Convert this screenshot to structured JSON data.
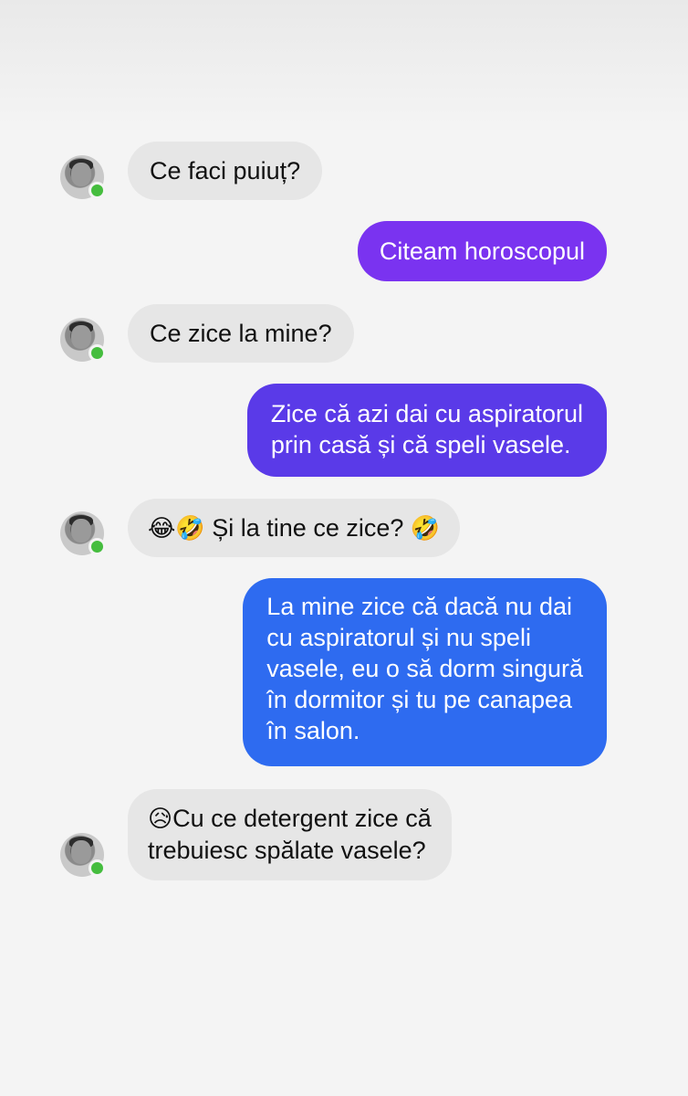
{
  "messages": [
    {
      "side": "incoming",
      "lines": [
        "Ce faci puiuț?"
      ]
    },
    {
      "side": "outgoing",
      "lines": [
        "Citeam horoscopul"
      ]
    },
    {
      "side": "incoming",
      "lines": [
        "Ce zice la mine?"
      ]
    },
    {
      "side": "outgoing",
      "lines": [
        "Zice că azi dai cu aspiratorul",
        "prin casă și că speli vasele."
      ]
    },
    {
      "side": "incoming",
      "emoji_prefix": "😂🤣",
      "lines": [
        " Și la tine ce zice? "
      ],
      "emoji_suffix": "🤣"
    },
    {
      "side": "outgoing",
      "lines": [
        "La mine zice că dacă nu dai",
        "cu aspiratorul și nu speli",
        "vasele, eu o să dorm singură",
        "în dormitor și tu pe canapea",
        "în salon."
      ]
    },
    {
      "side": "incoming",
      "emoji_prefix": "😥",
      "lines": [
        "Cu ce detergent zice că",
        "trebuiesc spălate vasele?"
      ]
    }
  ],
  "colors": {
    "incoming_bubble": "#e6e6e6",
    "outgoing_purple": "#7a33f0",
    "outgoing_violet": "#5a3ae8",
    "outgoing_blue": "#2e6bf0",
    "online_dot": "#45bd3e"
  },
  "icons": {
    "avatar": "contact-avatar",
    "status": "online-status-icon"
  }
}
